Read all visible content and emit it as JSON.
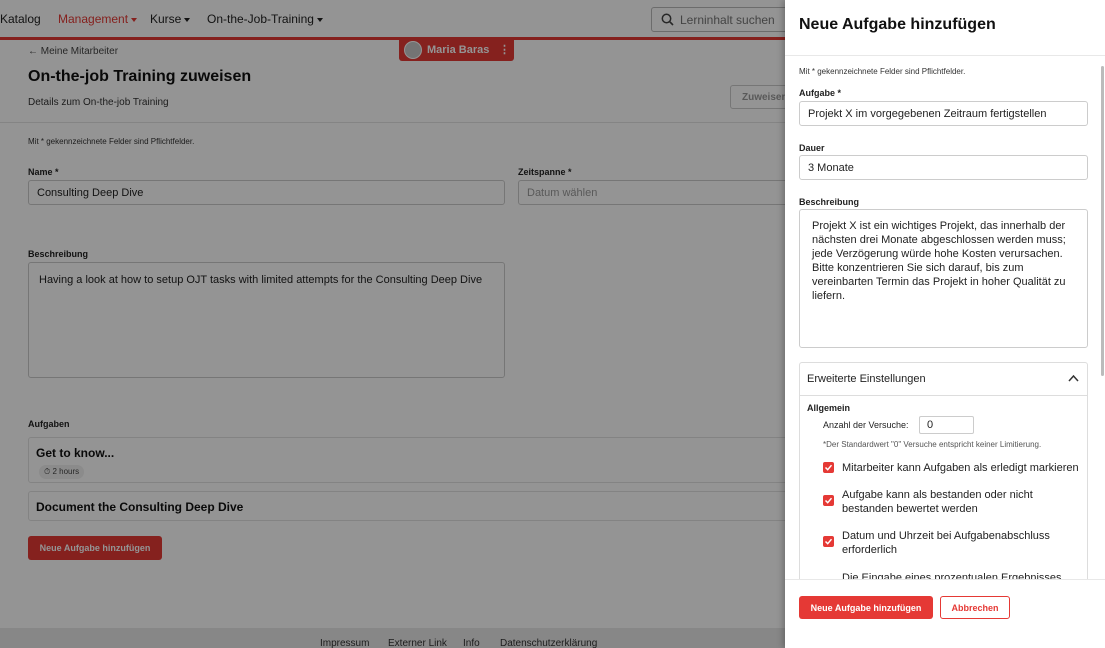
{
  "nav": {
    "items": [
      {
        "label": "Katalog",
        "active": false
      },
      {
        "label": "Management",
        "active": true
      },
      {
        "label": "Kurse",
        "active": false
      },
      {
        "label": "On-the-Job-Training",
        "active": false
      }
    ],
    "search_placeholder": "Lerninhalt suchen"
  },
  "user": {
    "name": "Maria Baras"
  },
  "page": {
    "back_link": "← Meine Mitarbeiter",
    "title": "On-the-job Training zuweisen",
    "subtitle": "Details zum On-the-job Training",
    "assign_button": "Zuweisen",
    "required_note": "Mit * gekennzeichnete Felder sind Pflichtfelder.",
    "name_label": "Name *",
    "name_value": "Consulting Deep Dive",
    "period_label": "Zeitspanne *",
    "period_placeholder": "Datum wählen",
    "description_label": "Beschreibung",
    "description_value": "Having a look at how to setup OJT tasks with limited attempts for the Consulting Deep Dive",
    "tasks_label": "Aufgaben",
    "tasks": [
      {
        "title": "Get to know...",
        "duration": "2 hours"
      },
      {
        "title": "Document the Consulting Deep Dive",
        "duration": ""
      }
    ],
    "add_task_button": "Neue Aufgabe hinzufügen"
  },
  "footer": {
    "links": [
      "Impressum",
      "Externer Link",
      "Info",
      "Datenschutzerklärung"
    ]
  },
  "drawer": {
    "title": "Neue Aufgabe hinzufügen",
    "required_note": "Mit * gekennzeichnete Felder sind Pflichtfelder.",
    "task_label": "Aufgabe *",
    "task_value": "Projekt X im vorgegebenen Zeitraum fertigstellen",
    "duration_label": "Dauer",
    "duration_value": "3 Monate",
    "description_label": "Beschreibung",
    "description_value": "Projekt X ist ein wichtiges Projekt, das innerhalb der nächsten drei Monate abgeschlossen werden muss; jede Verzögerung würde hohe Kosten verursachen. Bitte konzentrieren Sie sich darauf, bis zum vereinbarten Termin das Projekt in hoher Qualität zu liefern.",
    "advanced": {
      "title": "Erweiterte Einstellungen",
      "section": "Allgemein",
      "attempts_label": "Anzahl der Versuche:",
      "attempts_value": "0",
      "attempts_hint": "*Der Standardwert \"0\" Versuche entspricht keiner Limitierung.",
      "options": [
        {
          "label": "Mitarbeiter kann Aufgaben als erledigt markieren",
          "checked": true
        },
        {
          "label": "Aufgabe kann als bestanden oder nicht bestanden bewertet werden",
          "checked": true
        },
        {
          "label": "Datum und Uhrzeit bei Aufgabenabschluss erforderlich",
          "checked": true
        },
        {
          "label": "Die Eingabe eines prozentualen Ergebnisses",
          "checked": true
        }
      ]
    },
    "submit_button": "Neue Aufgabe hinzufügen",
    "cancel_button": "Abbrechen"
  },
  "colors": {
    "accent": "#e53935",
    "overlay": "rgba(0,0,0,0.42)"
  }
}
